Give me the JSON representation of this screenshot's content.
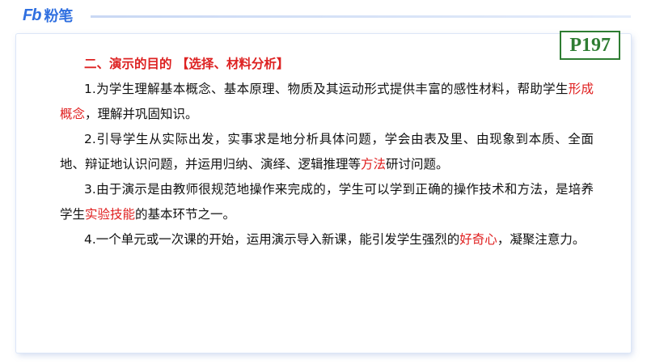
{
  "logo": {
    "mark": "Fb",
    "name": "粉笔"
  },
  "page_number": "P197",
  "heading": {
    "title": "二、演示的目的",
    "tag": "【选择、材料分析】"
  },
  "paragraphs": [
    {
      "before": "1.为学生理解基本概念、基本原理、物质及其运动形式提供丰富的感性材料，帮助学生",
      "highlight": "形成概念",
      "after": "，理解并巩固知识。"
    },
    {
      "before": "2.引导学生从实际出发，实事求是地分析具体问题，学会由表及里、由现象到本质、全面地、辩证地认识问题，并运用归纳、演绎、逻辑推理等",
      "highlight": "方法",
      "after": "研讨问题。"
    },
    {
      "before": "3.由于演示是由教师很规范地操作来完成的，学生可以学到正确的操作技术和方法，是培养学生",
      "highlight": "实验技能",
      "after": "的基本环节之一。"
    },
    {
      "before": "4.一个单元或一次课的开始，运用演示导入新课，能引发学生强烈的",
      "highlight": "好奇心",
      "after": "，凝聚注意力。"
    }
  ],
  "colors": {
    "accent_red": "#e02020",
    "heading_red": "#d22222",
    "badge_green": "#2e7d32",
    "brand_blue": "#2f6fe0"
  }
}
